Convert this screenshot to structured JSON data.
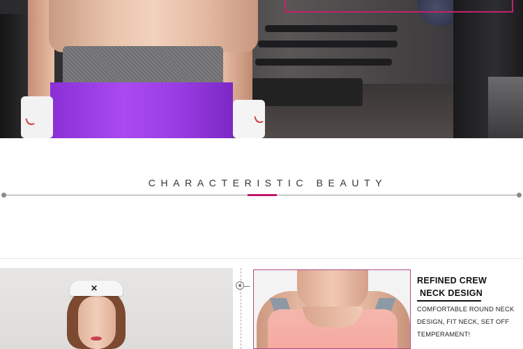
{
  "section": {
    "title": "CHARACTERISTIC BEAUTY"
  },
  "feature": {
    "heading_line1": "REFINED CREW",
    "heading_line2": "NECK DESIGN",
    "body": "COMFORTABLE ROUND NECK DESIGN, FIT NECK, SET OFF TEMPERAMENT!"
  },
  "colors": {
    "accent": "#c2186b",
    "frame": "#b14a86",
    "shorts": "#9a3ce4"
  },
  "icons": {
    "divider_marker": "target-icon"
  }
}
